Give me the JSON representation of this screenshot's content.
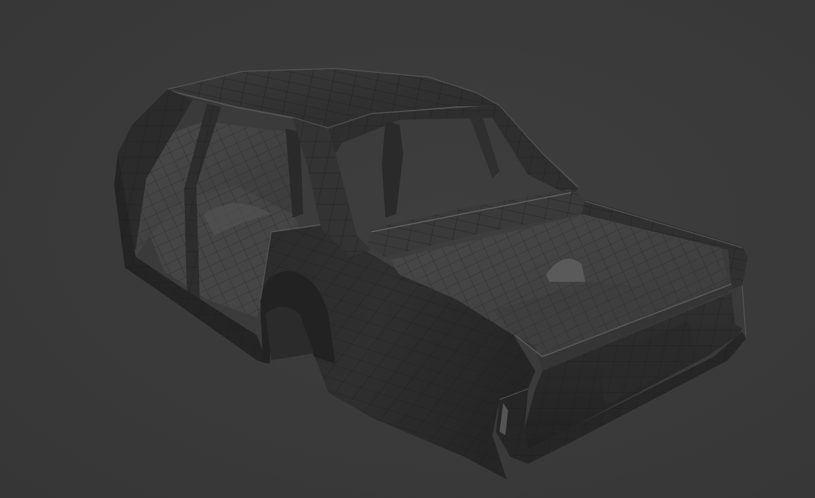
{
  "viewport": {
    "background_color": "#3a3a3a",
    "mesh_color": "#1a1a1a",
    "panel_dark": "#262626",
    "panel_mid": "#333333",
    "panel_light": "#4a4a4a",
    "highlight": "#6a6a6a"
  },
  "model": {
    "subject": "car-body-shell-wireframe"
  }
}
